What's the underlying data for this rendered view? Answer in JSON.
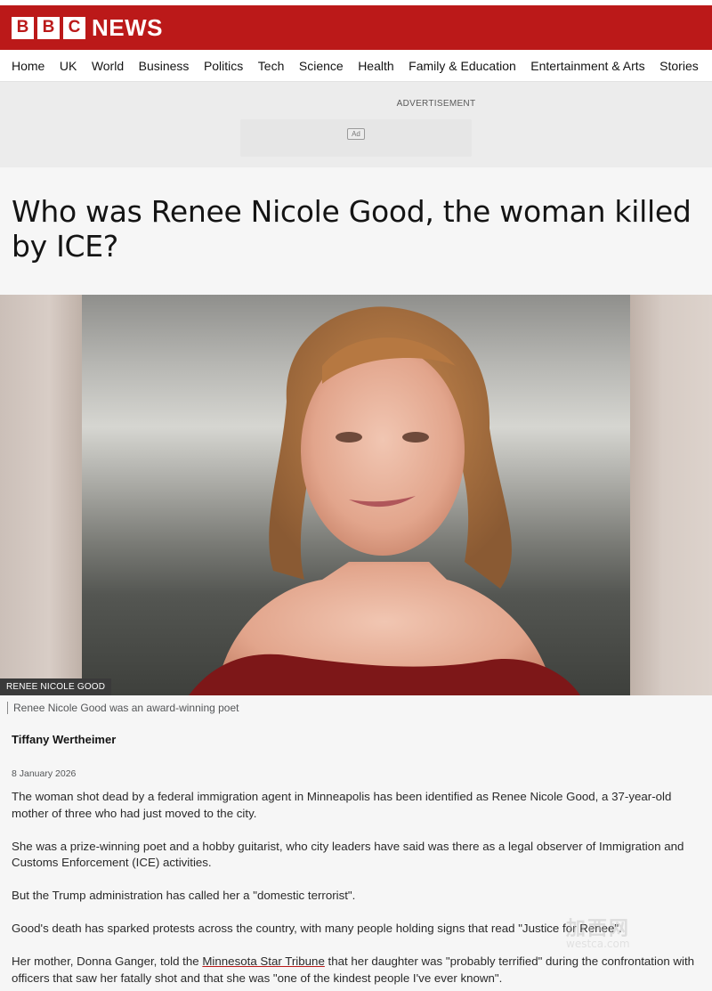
{
  "brand": {
    "blocks": [
      "B",
      "B",
      "C"
    ],
    "section": "NEWS",
    "color": "#bb1919"
  },
  "nav": {
    "items": [
      "Home",
      "UK",
      "World",
      "Business",
      "Politics",
      "Tech",
      "Science",
      "Health",
      "Family & Education",
      "Entertainment & Arts",
      "Stories"
    ]
  },
  "advertisement": {
    "label": "ADVERTISEMENT",
    "badge": "Ad"
  },
  "article": {
    "headline": "Who was Renee Nicole Good, the woman killed by ICE?",
    "image_credit": "RENEE NICOLE GOOD",
    "image_caption": "Renee Nicole Good was an award-winning poet",
    "author": "Tiffany Wertheimer",
    "date": "8 January 2026",
    "paragraphs": [
      "The woman shot dead by a federal immigration agent in Minneapolis has been identified as Renee Nicole Good, a 37-year-old mother of three who had just moved to the city.",
      "She was a prize-winning poet and a hobby guitarist, who city leaders have said was there as a legal observer of Immigration and Customs Enforcement (ICE) activities.",
      "But the Trump administration has called her a \"domestic terrorist\".",
      "Good's death has sparked protests across the country, with many people holding signs that read \"Justice for Renee\"."
    ],
    "last_paragraph": {
      "before_link": "Her mother, Donna Ganger, told the ",
      "link_text": "Minnesota Star Tribune",
      "after_link": " that her daughter was \"probably terrified\" during the confrontation with officers that saw her fatally shot and that she was \"one of the kindest people I've ever known\"."
    }
  },
  "watermark": {
    "cn": "加西网",
    "en": "westca.com"
  }
}
